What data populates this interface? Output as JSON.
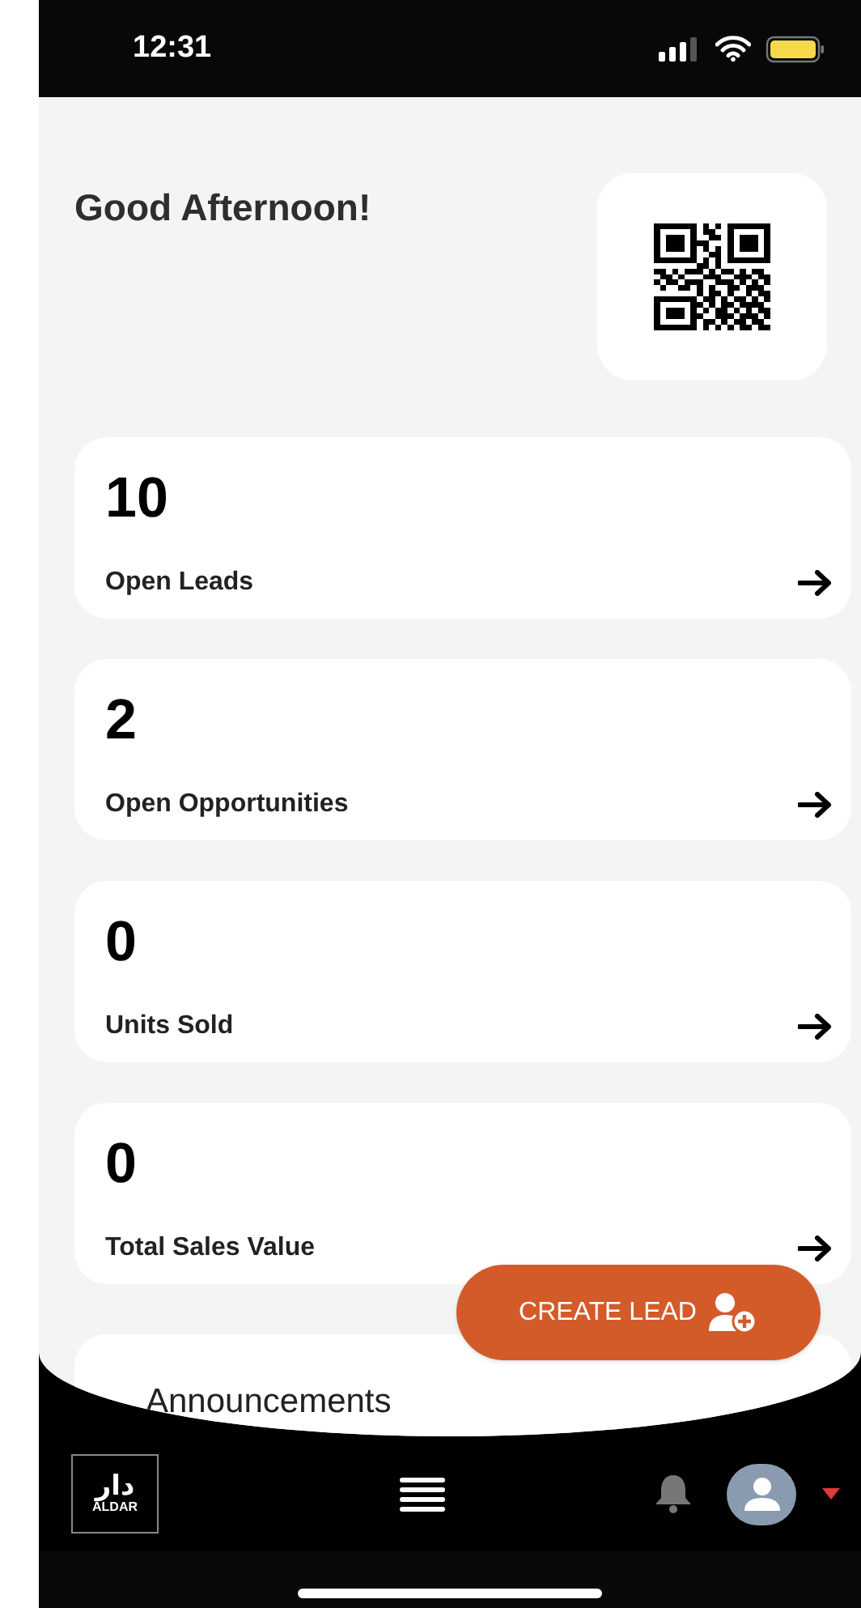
{
  "status_bar": {
    "time": "12:31"
  },
  "greeting": "Good Afternoon!",
  "stats": [
    {
      "value": "10",
      "label": "Open Leads"
    },
    {
      "value": "2",
      "label": "Open Opportunities"
    },
    {
      "value": "0",
      "label": "Units Sold"
    },
    {
      "value": "0",
      "label": "Total Sales Value"
    }
  ],
  "announcements": {
    "title": "Announcements"
  },
  "create_lead_button": {
    "label": "CREATE LEAD"
  },
  "bottom_nav": {
    "logo_mark": "دار",
    "logo_text": "ALDAR"
  }
}
